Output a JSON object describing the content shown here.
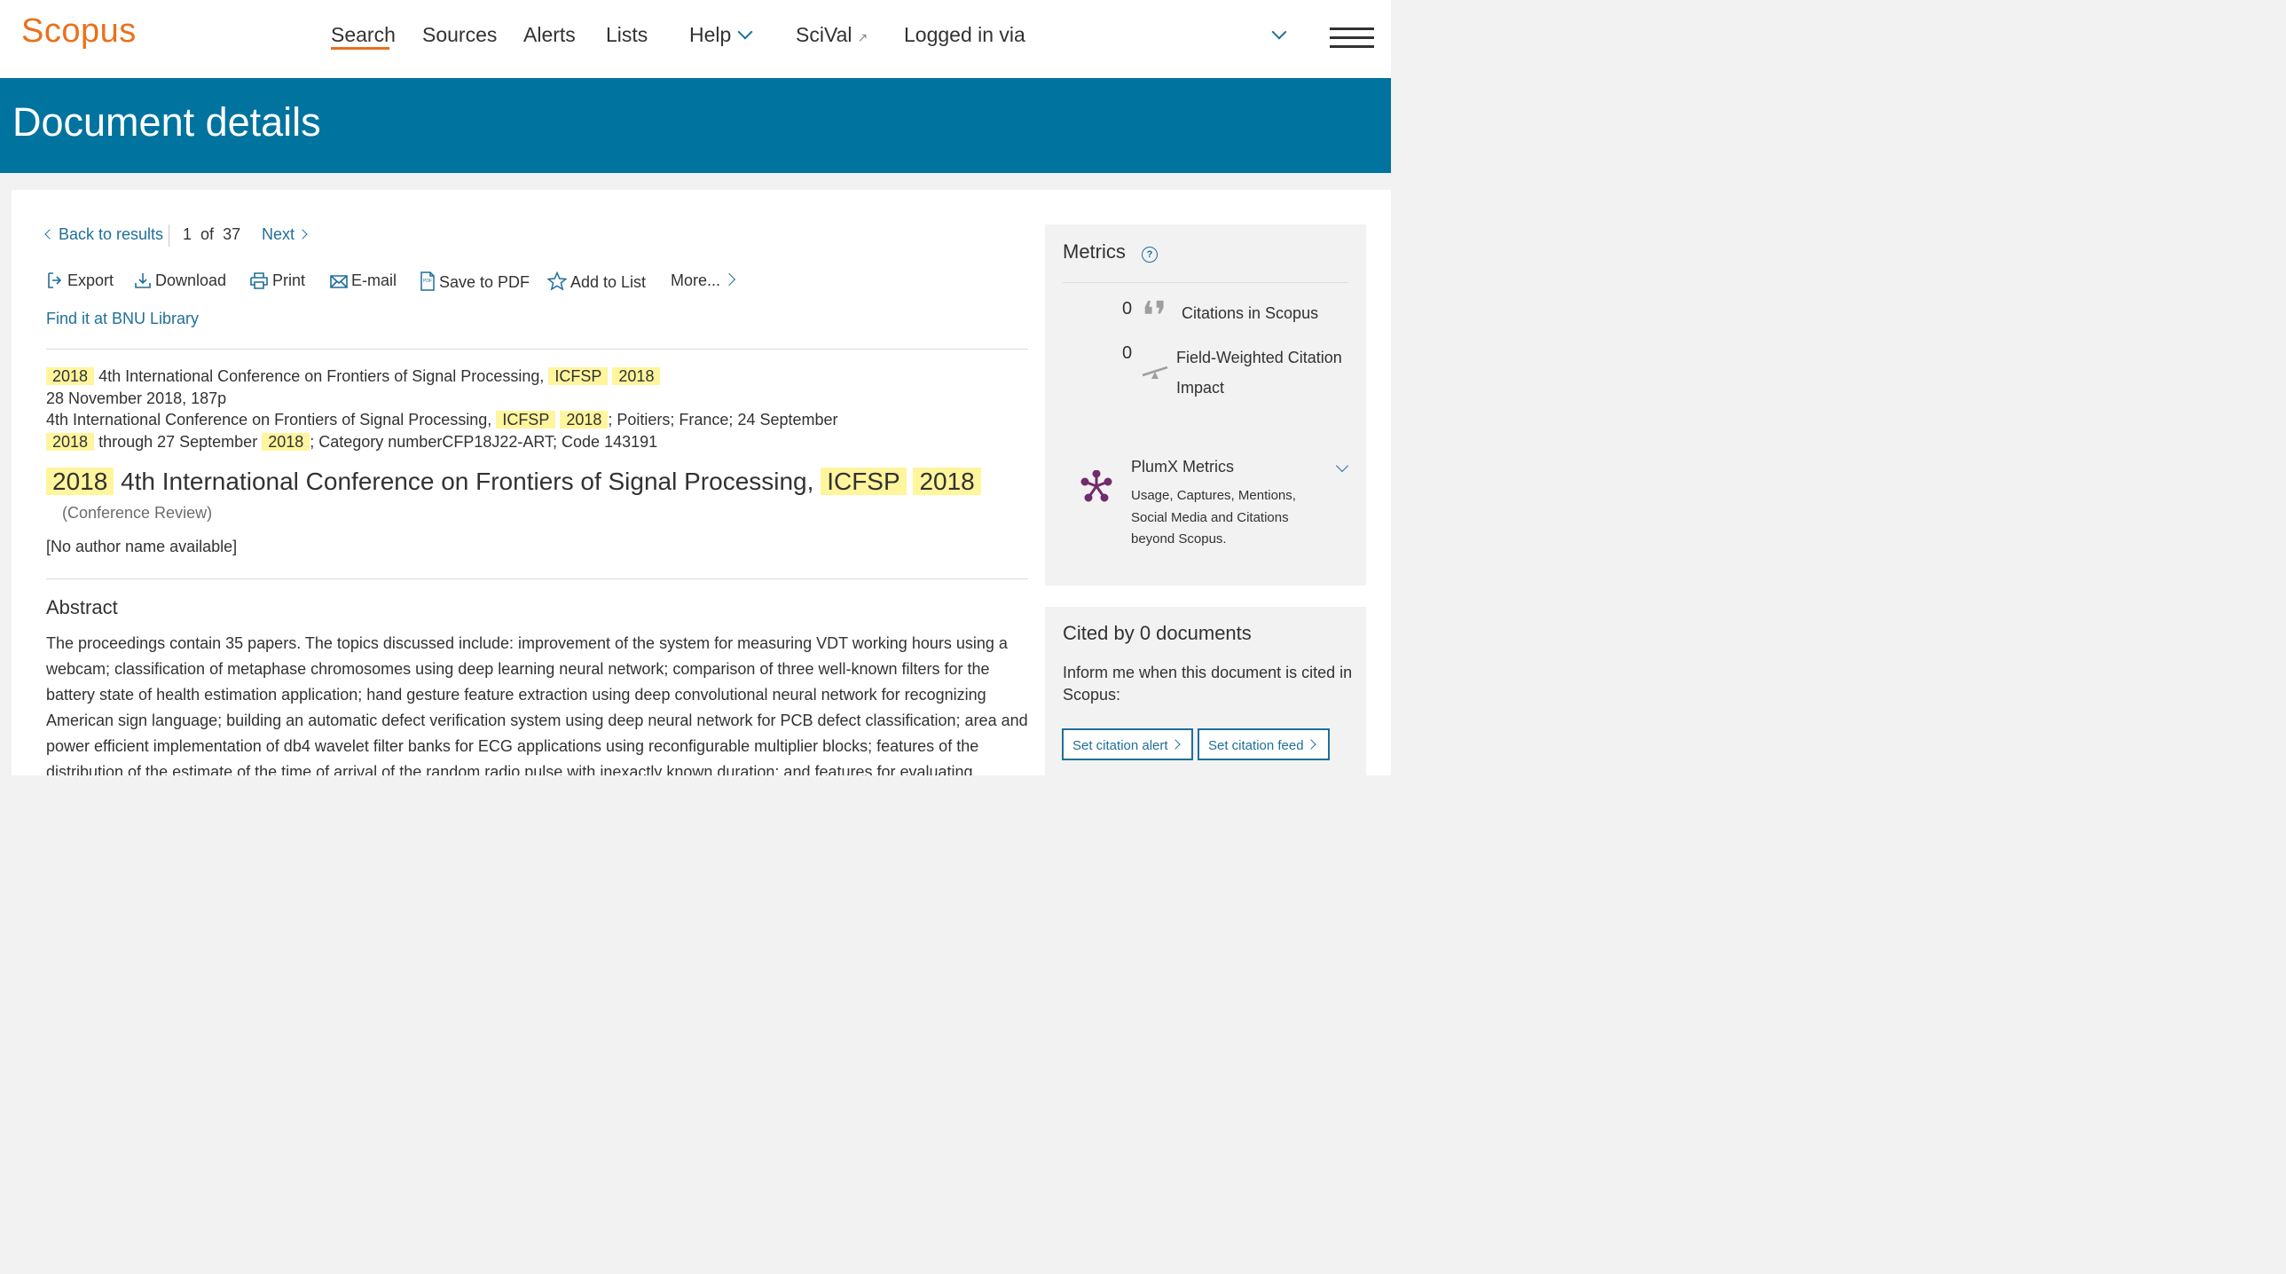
{
  "topnav": {
    "logo": "Scopus",
    "search": "Search",
    "sources": "Sources",
    "alerts": "Alerts",
    "lists": "Lists",
    "help": "Help",
    "scival": "SciVal",
    "login": "Logged in via"
  },
  "header": {
    "title": "Document details"
  },
  "pager": {
    "back": "Back to results",
    "position": "1",
    "of_label": "of",
    "total": "37",
    "next": "Next"
  },
  "toolbar": {
    "export": "Export",
    "download": "Download",
    "print": "Print",
    "email": "E-mail",
    "save_pdf": "Save to PDF",
    "add_list": "Add to List",
    "more": "More..."
  },
  "library_link": "Find it at BNU Library",
  "source": {
    "line1_a": "2018",
    "line1_b": "4th International Conference on Frontiers of Signal Processing,",
    "line1_c": "ICFSP",
    "line1_d": "2018",
    "line2": "28 November 2018, 187p",
    "line3_a": "4th International Conference on Frontiers of Signal Processing,",
    "line3_b": "ICFSP",
    "line3_c": "2018",
    "line3_d": "; Poitiers; France; 24 September",
    "line4_a": "2018",
    "line4_b": "through 27 September",
    "line4_c": "2018",
    "line4_d": "; Category numberCFP18J22-ART; Code 143191"
  },
  "document": {
    "title_a": "2018",
    "title_b": "4th International Conference on Frontiers of Signal Processing,",
    "title_c": "ICFSP",
    "title_d": "2018",
    "type": "(Conference Review)",
    "authors": "[No author name available]"
  },
  "abstract": {
    "heading": "Abstract",
    "text": "The proceedings contain 35 papers. The topics discussed include: improvement of the system for measuring VDT working hours using a webcam; classification of metaphase chromosomes using deep learning neural network; comparison of three well-known filters for the battery state of health estimation application; hand gesture feature extraction using deep convolutional neural network for recognizing American sign language; building an automatic defect verification system using deep neural network for PCB defect classification; area and power efficient implementation of db4 wavelet filter banks for ECG applications using reconfigurable multiplier blocks; features of the distribution of the estimate of the time of arrival of the random radio pulse with inexactly known duration; and features for evaluating"
  },
  "metrics": {
    "title": "Metrics",
    "help": "?",
    "citations_value": "0",
    "citations_label": "Citations in Scopus",
    "fwci_value": "0",
    "fwci_label_1": "Field-Weighted Citation",
    "fwci_label_2": "Impact",
    "plumx_title": "PlumX Metrics",
    "plumx_desc": "Usage, Captures, Mentions, Social Media and Citations beyond Scopus."
  },
  "cited_by": {
    "title": "Cited by 0 documents",
    "text": "Inform me when this document is cited in Scopus:",
    "alert_button": "Set citation alert",
    "feed_button": "Set citation feed"
  },
  "colors": {
    "brand": "#e9711c",
    "header": "#00739e",
    "link": "#1f6f99",
    "highlight": "#fff59d"
  }
}
